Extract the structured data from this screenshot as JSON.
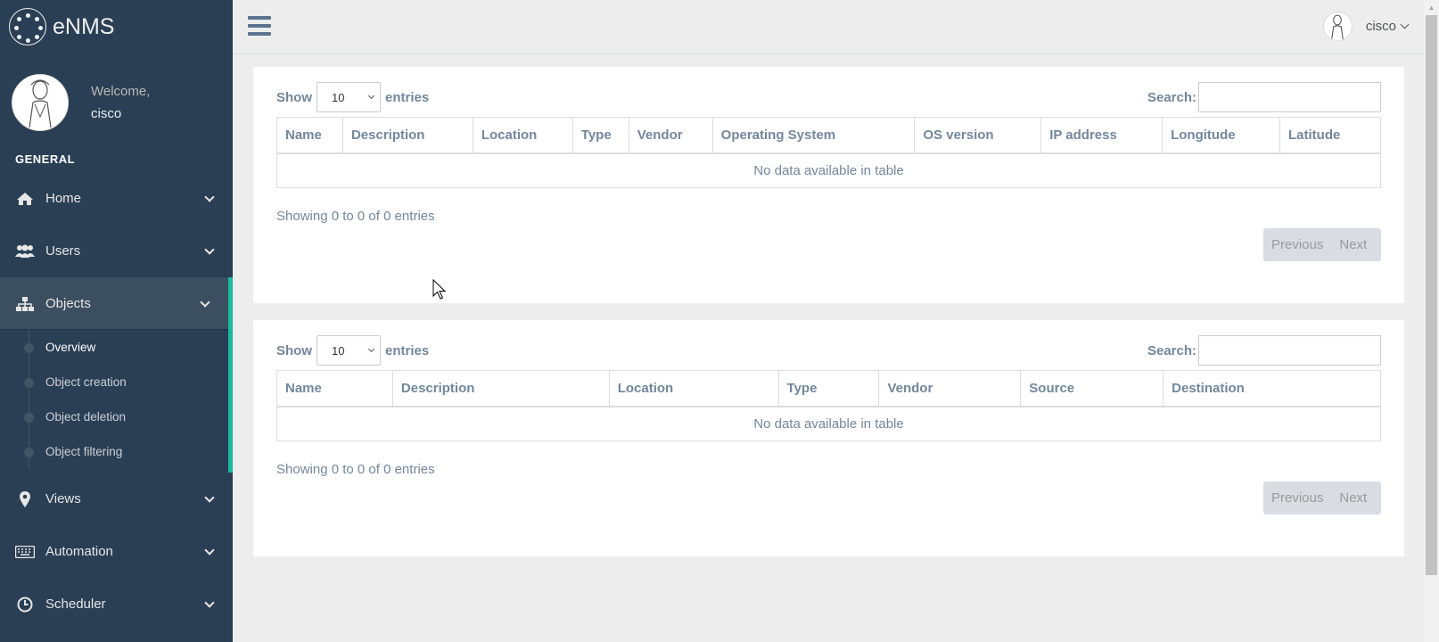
{
  "sidebar": {
    "brand": "eNMS",
    "welcome": "Welcome,",
    "username": "cisco",
    "section_title": "GENERAL",
    "menu": [
      {
        "label": "Home",
        "icon": "home-icon"
      },
      {
        "label": "Users",
        "icon": "users-icon"
      },
      {
        "label": "Objects",
        "icon": "sitemap-icon"
      },
      {
        "label": "Views",
        "icon": "map-pin-icon"
      },
      {
        "label": "Automation",
        "icon": "keyboard-icon"
      },
      {
        "label": "Scheduler",
        "icon": "clock-icon"
      }
    ],
    "objects_submenu": [
      "Overview",
      "Object creation",
      "Object deletion",
      "Object filtering"
    ]
  },
  "topnav": {
    "user": "cisco"
  },
  "devices_table": {
    "show_label": "Show",
    "length_value": "10",
    "entries_label": "entries",
    "search_label": "Search:",
    "columns": [
      "Name",
      "Description",
      "Location",
      "Type",
      "Vendor",
      "Operating System",
      "OS version",
      "IP address",
      "Longitude",
      "Latitude"
    ],
    "empty_text": "No data available in table",
    "info": "Showing 0 to 0 of 0 entries",
    "prev": "Previous",
    "next": "Next"
  },
  "links_table": {
    "show_label": "Show",
    "length_value": "10",
    "entries_label": "entries",
    "search_label": "Search:",
    "columns": [
      "Name",
      "Description",
      "Location",
      "Type",
      "Vendor",
      "Source",
      "Destination"
    ],
    "empty_text": "No data available in table",
    "info": "Showing 0 to 0 of 0 entries",
    "prev": "Previous",
    "next": "Next"
  },
  "colors": {
    "sidebar_bg": "#2a3f54",
    "accent": "#1abb9c",
    "text": "#73879c"
  }
}
